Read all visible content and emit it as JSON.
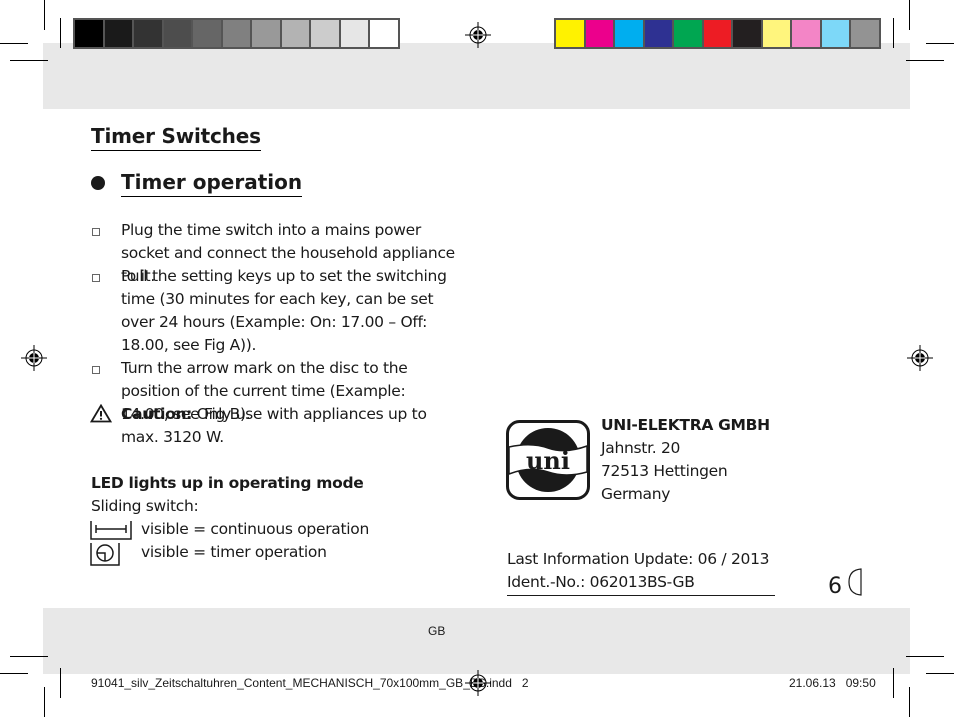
{
  "color_bar_gray": [
    "#000000",
    "#1a1a1a",
    "#333333",
    "#4d4d4d",
    "#666666",
    "#808080",
    "#999999",
    "#b3b3b3",
    "#cccccc",
    "#e6e6e6",
    "#ffffff"
  ],
  "color_bar_color": [
    "#fff200",
    "#ec008c",
    "#00aeef",
    "#2e3192",
    "#00a651",
    "#ed1c24",
    "#231f20",
    "#fff57d",
    "#f385c6",
    "#7dd8f8",
    "#939393"
  ],
  "section_title": "Timer Switches",
  "subsection_title": "Timer operation",
  "steps": [
    "Plug the time switch into a mains power socket and connect the household appliance to it.",
    "Pull the setting keys up to set the switching time (30 minutes for each key, can be set over 24 hours (Example: On: 17.00 – Off: 18.00, see Fig A)).",
    "Turn the arrow mark on the disc to the position of the current time (Example: 14.00, see Fig B)."
  ],
  "caution": {
    "label": "Caution:",
    "text": " Only use with appliances up to max. 3120 W.",
    "icon": "warning-triangle-icon"
  },
  "led": {
    "heading": "LED lights up in operating mode",
    "sliding_switch": "Sliding switch:",
    "continuous": "visible = continuous operation",
    "timer": "visible = timer operation"
  },
  "company": {
    "logo_text": "uni",
    "name": "UNI-ELEKTRA GMBH",
    "street": "Jahnstr. 20",
    "city": "72513 Hettingen",
    "country": "Germany"
  },
  "info_update": "Last Information Update: 06 / 2013",
  "ident_no": "Ident.-No.: 062013BS-GB",
  "page_number": "6",
  "language": "GB",
  "slug_file": "91041_silv_Zeitschaltuhren_Content_MECHANISCH_70x100mm_GB_BS.indd   2",
  "slug_date": "21.06.13   09:50"
}
